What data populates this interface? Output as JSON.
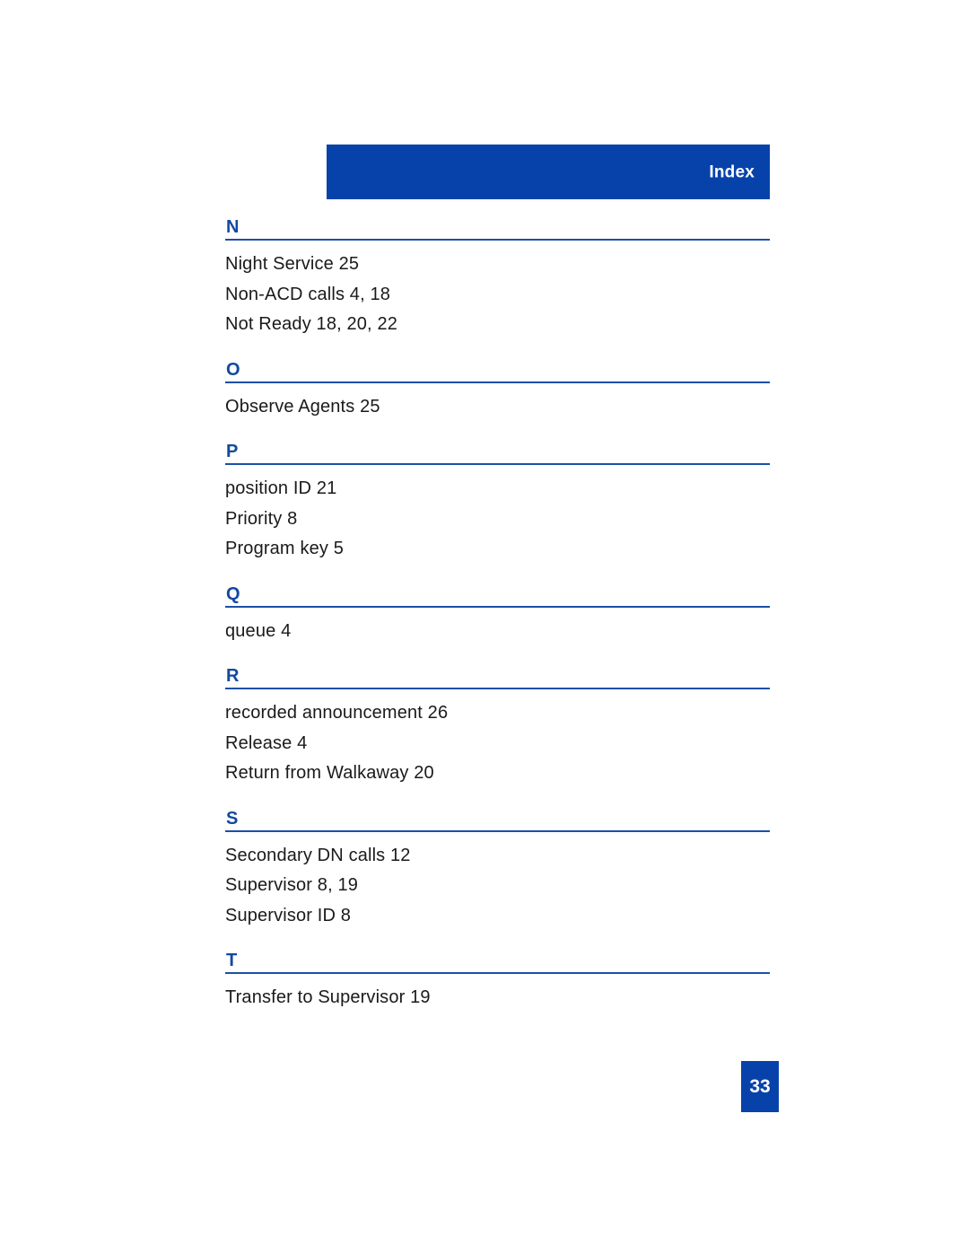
{
  "header": {
    "title": "Index",
    "banner_color": "#0742AA"
  },
  "colors": {
    "banner_blue": "#0742AA",
    "letter_blue": "#12499F",
    "rule_blue": "#1B4FA8",
    "text_black": "#1a1a1a",
    "page_background": "#ffffff"
  },
  "index": {
    "sections": [
      {
        "letter": "N",
        "entries": [
          "Night Service 25",
          "Non-ACD calls 4, 18",
          "Not Ready 18, 20, 22"
        ]
      },
      {
        "letter": "O",
        "entries": [
          "Observe Agents 25"
        ]
      },
      {
        "letter": "P",
        "entries": [
          "position ID 21",
          "Priority 8",
          "Program key 5"
        ]
      },
      {
        "letter": "Q",
        "entries": [
          "queue 4"
        ]
      },
      {
        "letter": "R",
        "entries": [
          "recorded announcement 26",
          "Release 4",
          "Return from Walkaway 20"
        ]
      },
      {
        "letter": "S",
        "entries": [
          "Secondary DN calls 12",
          "Supervisor 8, 19",
          "Supervisor ID 8"
        ]
      },
      {
        "letter": "T",
        "entries": [
          "Transfer to Supervisor 19"
        ]
      }
    ]
  },
  "footer": {
    "page_number": "33"
  }
}
